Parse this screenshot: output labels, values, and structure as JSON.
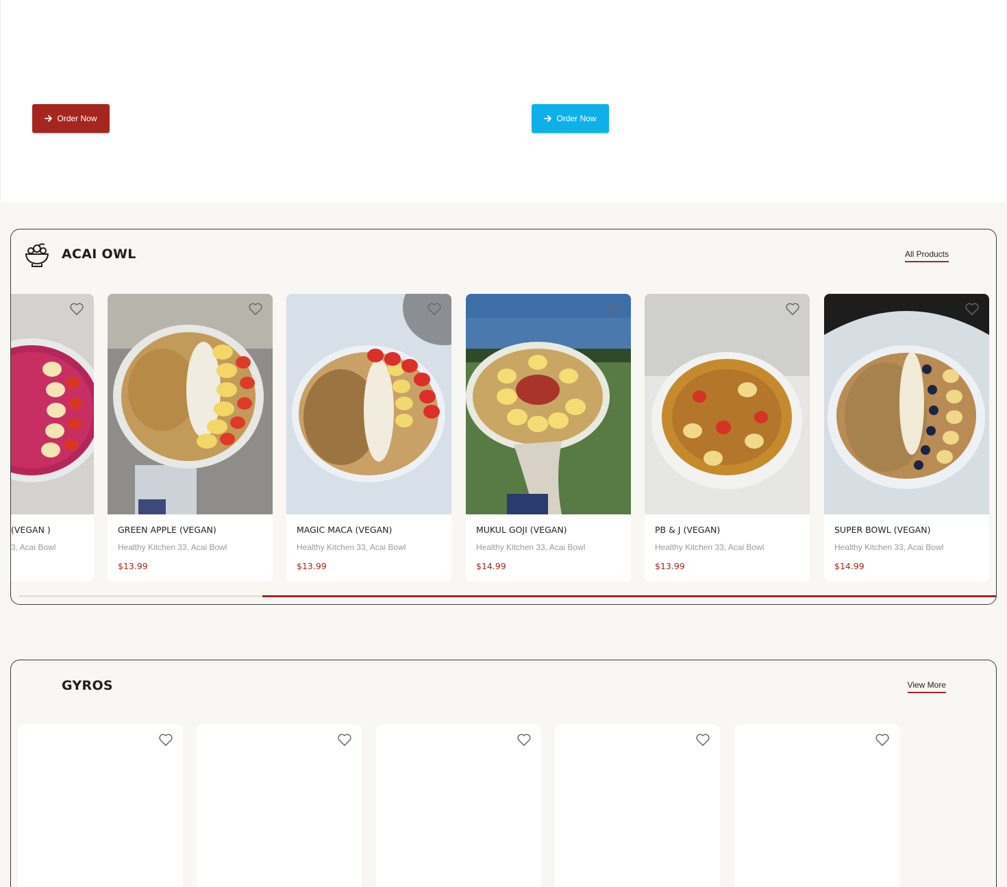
{
  "banner": {
    "order_left_label": "Order Now",
    "order_right_label": "Order Now",
    "order_left_color": "#a5261f",
    "order_right_color": "#0fb0ea"
  },
  "acai": {
    "title": "ACAI OWL",
    "link_label": "All Products",
    "icon": "acai-bowl-icon",
    "products": [
      {
        "name": "(VEGAN )",
        "subtitle": "3, Acai Bowl",
        "price": ""
      },
      {
        "name": "GREEN APPLE (VEGAN)",
        "subtitle": "Healthy Kitchen 33, Acai Bowl",
        "price": "$13.99"
      },
      {
        "name": "MAGIC MACA (VEGAN)",
        "subtitle": "Healthy Kitchen 33, Acai Bowl",
        "price": "$13.99"
      },
      {
        "name": "MUKUL GOJI (VEGAN)",
        "subtitle": "Healthy Kitchen 33, Acai Bowl",
        "price": "$14.99"
      },
      {
        "name": "PB & J (VEGAN)",
        "subtitle": "Healthy Kitchen 33, Acai Bowl",
        "price": "$13.99"
      },
      {
        "name": "SUPER BOWL (VEGAN)",
        "subtitle": "Healthy Kitchen 33, Acai Bowl",
        "price": "$14.99"
      }
    ],
    "scroll_position": 0.25
  },
  "gyros": {
    "title": "GYROS",
    "link_label": "View More",
    "card_count": 5
  },
  "colors": {
    "accent": "#a5261f",
    "background": "#f8f7f4"
  }
}
